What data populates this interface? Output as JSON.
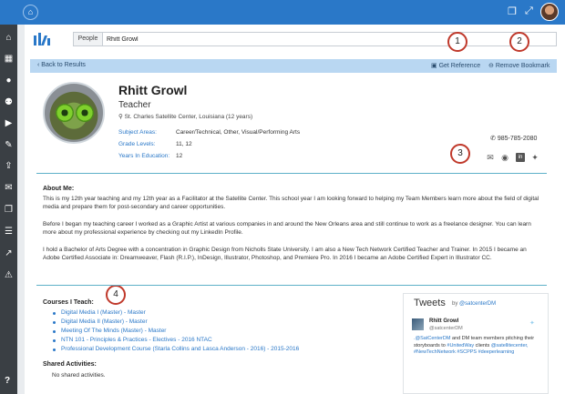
{
  "search": {
    "category": "People",
    "value": "Rhitt Growl"
  },
  "actions": {
    "back": "Back to Results",
    "get_reference": "Get Reference",
    "remove_bookmark": "Remove Bookmark"
  },
  "callouts": [
    "1",
    "2",
    "3",
    "4"
  ],
  "profile": {
    "name": "Rhitt Growl",
    "role": "Teacher",
    "location": "St. Charles Satellite Center, Louisiana (12 years)",
    "fields": [
      {
        "label": "Subject Areas:",
        "value": "Career/Technical, Other, Visual/Performing Arts"
      },
      {
        "label": "Grade Levels:",
        "value": "11, 12"
      },
      {
        "label": "Years In Education:",
        "value": "12"
      }
    ],
    "phone": "985-785-2080"
  },
  "about": {
    "title": "About Me:",
    "paragraphs": [
      "This is my 12th year teaching and my 12th year as a Facilitator at the Satellite Center. This school year I am looking forward to helping my Team Members learn more about the field of digital media and prepare them for post-secondary and career opportunities.",
      "Before I began my teaching career I worked as a Graphic Artist at various companies in and around the New Orleans area and still continue to work as a freelance designer. You can learn more about my professional experience by checking out my LinkedIn Profile.",
      "I hold a Bachelor of Arts Degree with a concentration in Graphic Design from Nicholls State University. I am also a New Tech Network Certified Teacher and Trainer. In 2015 I became an Adobe Certified Associate in: Dreamweaver, Flash (R.I.P.), InDesign, Illustrator, Photoshop, and Premiere Pro. In 2016 I became an Adobe Certified Expert in Illustrator CC."
    ]
  },
  "courses": {
    "title": "Courses I Teach:",
    "items": [
      "Digital Media I (Master) - Master",
      "Digital Media II (Master) - Master",
      "Meeting Of The Minds (Master) - Master",
      "NTN 101 - Principles & Practices - Electives - 2016 NTAC",
      "Professional Development Course (Starla Collins and Lasca Anderson - 2016) - 2015-2016"
    ]
  },
  "shared": {
    "title": "Shared Activities:",
    "empty": "No shared activities."
  },
  "tweets": {
    "title": "Tweets",
    "by": "by",
    "handle": "@satcenterDM",
    "author": "Rhitt Growl",
    "author_handle": "@satcenterDM",
    "text_lead": ".@SatCenterDM",
    "text_body": " and DM team members pitching their storyboards to ",
    "text_tag1": "#UnitedWay",
    "text_tail": " clients ",
    "text_line2": "@satellitecenter, #NewTechNetwork #SCPPS #deeperlearning"
  },
  "help": "?"
}
